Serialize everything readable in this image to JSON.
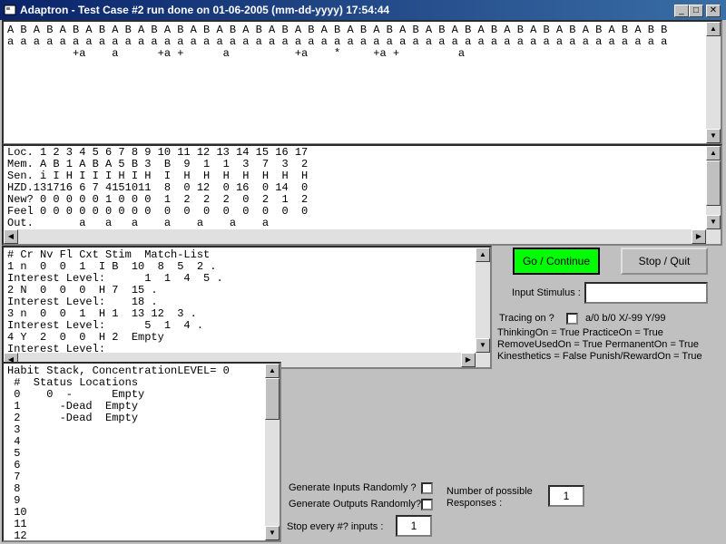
{
  "window": {
    "title": "Adaptron - Test Case #2 run done on 01-06-2005 (mm-dd-yyyy) 17:54:44",
    "controls": {
      "minimize": "_",
      "maximize": "□",
      "close": "✕"
    }
  },
  "sequence_pane": {
    "lines": [
      "A B A B A B A B A B A B A B A B A B A B A B A B A B A B A B A B A B A B A B A B A B A B A B A B A B B",
      "a a a a a a a a a a a a a a a a a a a a a a a a a a a a a a a a a a a a a a a a a a a a a a a a a a a",
      "          +a    a      +a +      a          +a    *     +a +         a"
    ]
  },
  "memory_pane": {
    "lines": [
      "Loc. 1 2 3 4 5 6 7 8 9 10 11 12 13 14 15 16 17",
      "Mem. A B 1 A B A 5 B 3  B  9  1  1  3  7  3  2",
      "Sen. i I H I I I H I H  I  H  H  H  H  H  H  H",
      "HZD.131716 6 7 4151011  8  0 12  0 16  0 14  0",
      "New? 0 0 0 0 0 1 0 0 0  1  2  2  2  0  2  1  2",
      "Feel 0 0 0 0 0 0 0 0 0  0  0  0  0  0  0  0  0",
      "Out.       a   a   a    a    a    a    a"
    ]
  },
  "match_pane": {
    "lines": [
      "# Cr Nv Fl Cxt Stim  Match-List",
      "1 n  0  0  1  I B  10  8  5  2 .",
      "Interest Level:      1  1  4  5 .",
      "2 N  0  0  0  H 7  15 .",
      "Interest Level:    18 .",
      "3 n  0  0  1  H 1  13 12  3 .",
      "Interest Level:      5  1  4 .",
      "4 Y  2  0  0  H 2  Empty",
      "Interest Level:"
    ]
  },
  "habit_pane": {
    "lines": [
      "Habit Stack, ConcentrationLEVEL= 0",
      " #  Status Locations",
      " 0    0  -      Empty",
      " 1      -Dead  Empty",
      " 2      -Dead  Empty",
      " 3",
      " 4",
      " 5",
      " 6",
      " 7",
      " 8",
      " 9",
      " 10",
      " 11",
      " 12"
    ]
  },
  "controls": {
    "go_label": "Go / Continue",
    "stop_label": "Stop / Quit",
    "input_stimulus_label": "Input Stimulus :",
    "input_stimulus_value": "",
    "tracing_label": "Tracing on ?",
    "tracing_hint": "a/0  b/0  X/-99  Y/99",
    "status_lines": [
      "ThinkingOn = True PracticeOn = True",
      "RemoveUsedOn = True PermanentOn = True",
      "Kinesthetics = False Punish/RewardOn = True"
    ],
    "gen_inputs_label": "Generate Inputs Randomly ?",
    "gen_outputs_label": "Generate Outputs Randomly?",
    "stop_every_label": "Stop every #? inputs :",
    "stop_every_value": "1",
    "num_responses_label_1": "Number of possible",
    "num_responses_label_2": "Responses :",
    "num_responses_value": "1"
  },
  "colors": {
    "go_button": "#00ff00",
    "title_start": "#0a246a",
    "title_end": "#3a6ea5"
  }
}
